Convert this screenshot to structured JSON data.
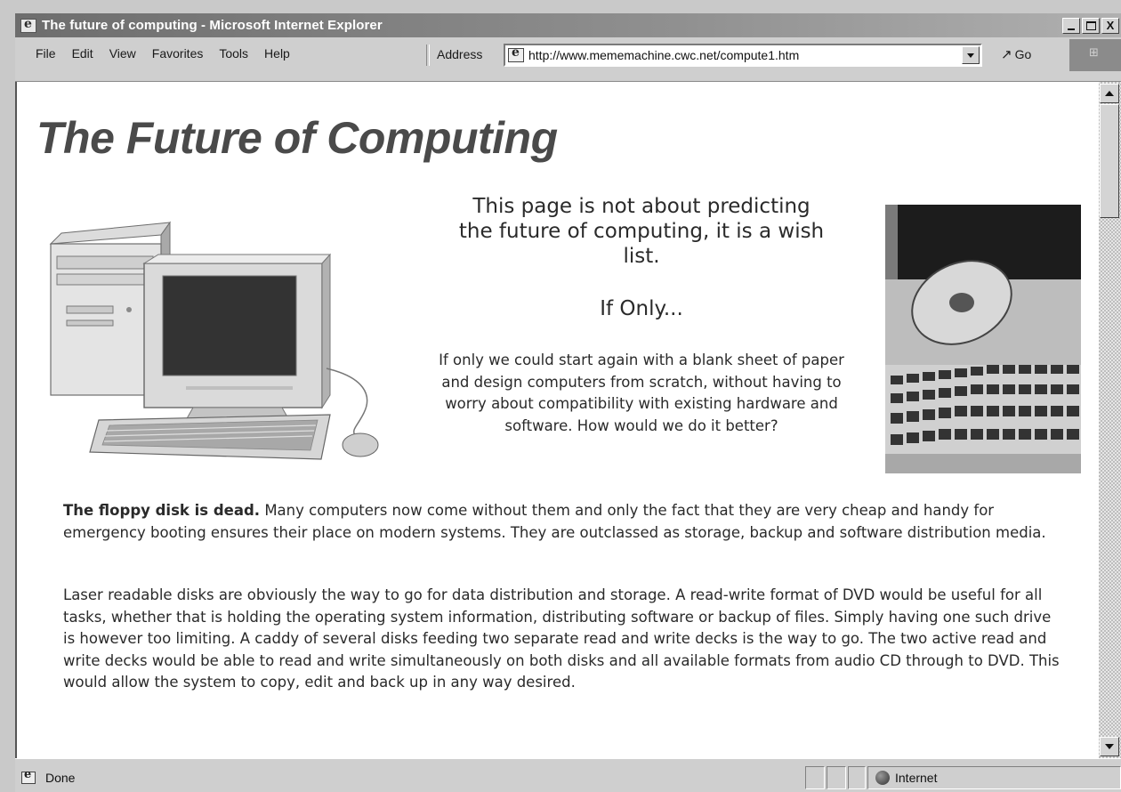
{
  "window": {
    "title": "The future of computing - Microsoft Internet Explorer",
    "buttons": {
      "minimize": "",
      "maximize": "",
      "close": "X"
    }
  },
  "menu": {
    "items": [
      "File",
      "Edit",
      "View",
      "Favorites",
      "Tools",
      "Help"
    ]
  },
  "address_bar": {
    "label": "Address",
    "url": "http://www.mememachine.cwc.net/compute1.htm",
    "go_label": "Go"
  },
  "page": {
    "heading": "The Future of Computing",
    "intro": "This page is not about predicting the future of computing, it is a wish list.",
    "subheading": "If Only...",
    "center_paragraph": "If only we could start again with a blank sheet of paper and design computers from scratch, without having to worry about compatibility with existing hardware and software. How would we do it better?",
    "paragraph1_bold": "The floppy disk is dead.",
    "paragraph1_rest": " Many computers now come without them and only the fact that they are very cheap and handy for emergency booting ensures their place on modern systems. They are outclassed as storage, backup and software distribution media.",
    "paragraph2": "Laser readable disks are obviously the way to go for data distribution and storage. A read-write format of DVD would be useful for all tasks, whether that is holding the operating system information, distributing software or backup of files. Simply having one such drive is however too limiting. A caddy of several disks feeding two separate read and write decks is the way to go. The two active read and write decks would be able to read and write simultaneously on both disks and all available formats from audio CD through to DVD. This would allow the system to copy, edit and back up in any way desired."
  },
  "status": {
    "text": "Done",
    "zone": "Internet"
  },
  "colors": {
    "titlebar_start": "#6d6d6d",
    "chrome": "#cfcfcf",
    "heading": "#4a4a4a",
    "body_text": "#2a2a2a"
  }
}
